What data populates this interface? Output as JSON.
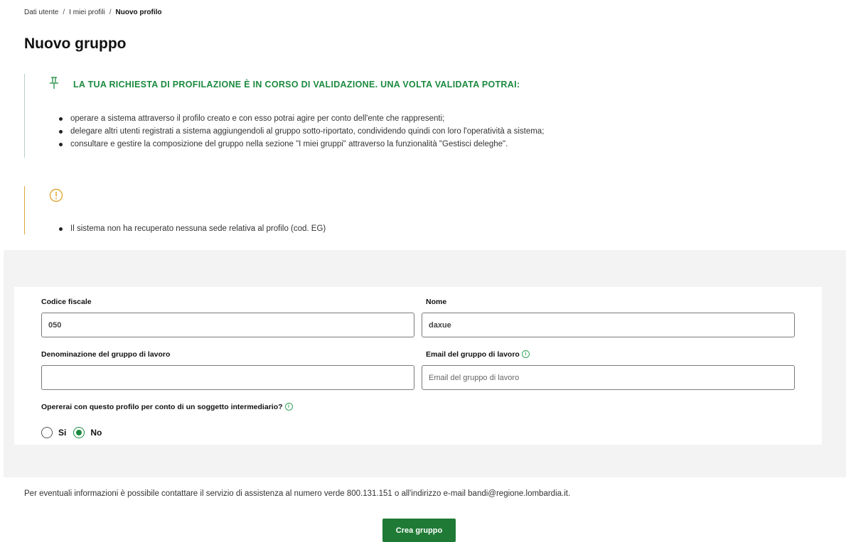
{
  "breadcrumb": {
    "items": [
      "Dati utente",
      "I miei profili",
      "Nuovo profilo"
    ],
    "separator": "/"
  },
  "page": {
    "title": "Nuovo gruppo"
  },
  "info_callout": {
    "icon": "pin-icon",
    "accent_color": "#1b8a3e",
    "title": "LA TUA RICHIESTA DI PROFILAZIONE È IN CORSO DI VALIDAZIONE. UNA VOLTA VALIDATA POTRAI:",
    "items": [
      "operare a sistema attraverso il profilo creato e con esso potrai agire per conto dell'ente che rappresenti;",
      "delegare altri utenti registrati a sistema aggiungendoli al gruppo sotto-riportato, condividendo quindi con loro l'operatività a sistema;",
      "consultare e gestire la composizione del gruppo nella sezione \"I miei gruppi\" attraverso la funzionalità \"Gestisci deleghe\"."
    ]
  },
  "warning_callout": {
    "icon": "warning-icon",
    "accent_color": "#e0a83a",
    "items": [
      "Il sistema non ha recuperato nessuna sede relativa al profilo (cod. EG)"
    ]
  },
  "form": {
    "codice_fiscale": {
      "label": "Codice fiscale",
      "value": "050"
    },
    "nome": {
      "label": "Nome",
      "value": "daxue"
    },
    "denominazione": {
      "label": "Denominazione del gruppo di lavoro",
      "value": ""
    },
    "email": {
      "label": "Email del gruppo di lavoro",
      "placeholder": "Email del gruppo di lavoro",
      "value": ""
    },
    "intermediario": {
      "label": "Opererai con questo profilo per conto di un soggetto intermediario?",
      "options": [
        "Si",
        "No"
      ],
      "selected": "No"
    }
  },
  "footer": {
    "contact_text": "Per eventuali informazioni è possibile contattare il servizio di assistenza al numero verde 800.131.151 o all'indirizzo e-mail bandi@regione.lombardia.it.",
    "submit_label": "Crea gruppo"
  }
}
